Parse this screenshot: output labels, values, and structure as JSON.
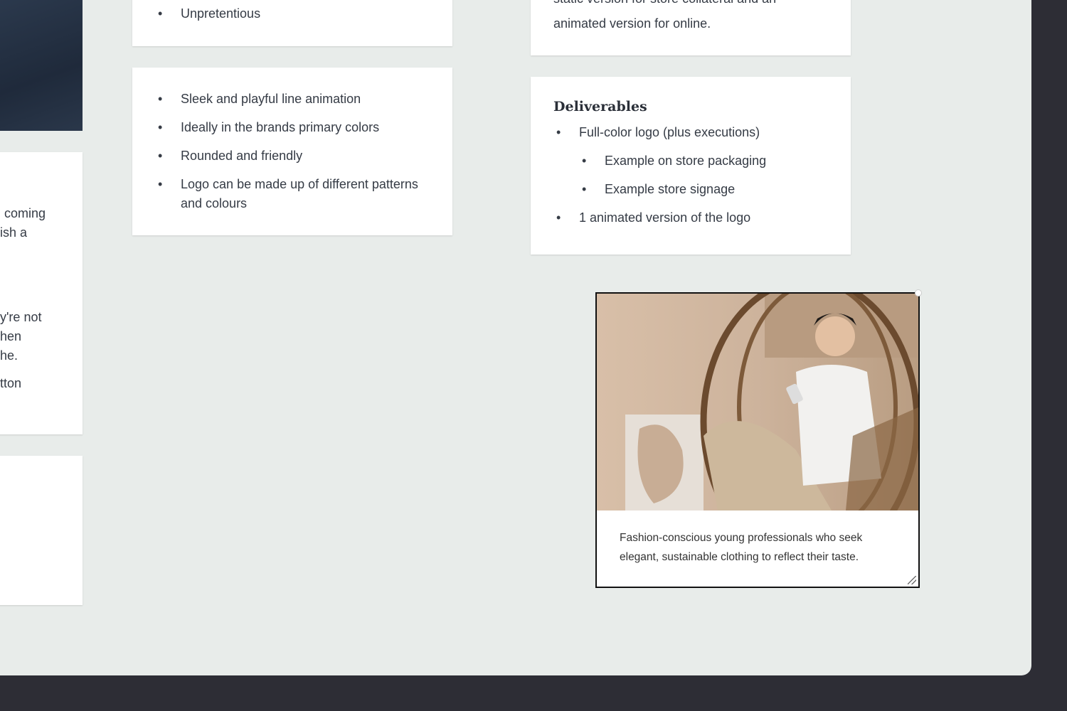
{
  "left_column": {
    "card1_fragments": [
      "coming",
      "ish a"
    ],
    "card1_fragments2": [
      "y're not",
      "hen",
      "he."
    ],
    "card1_fragment3": "tton"
  },
  "card_style": {
    "items": [
      "Unpretentious"
    ]
  },
  "card_logo": {
    "items": [
      "Sleek and playful line animation",
      "Ideally in the brands primary colors",
      "Rounded and friendly",
      "Logo can be made up of different patterns and colours"
    ]
  },
  "card_format": {
    "lines": [
      "static version for store collateral and an",
      "animated version for online."
    ]
  },
  "card_deliverables": {
    "title": "Deliverables",
    "items": [
      "Full-color logo (plus executions)",
      "Example on store packaging",
      "Example store signage",
      "1 animated version of the logo"
    ]
  },
  "image_card": {
    "caption_line1": "Fashion-conscious young professionals who seek",
    "caption_line2": "elegant, sustainable clothing to reflect their taste."
  },
  "colors": {
    "canvas": "#e8ecea",
    "frame": "#2d2d35",
    "card": "#ffffff",
    "text": "#353b45"
  }
}
